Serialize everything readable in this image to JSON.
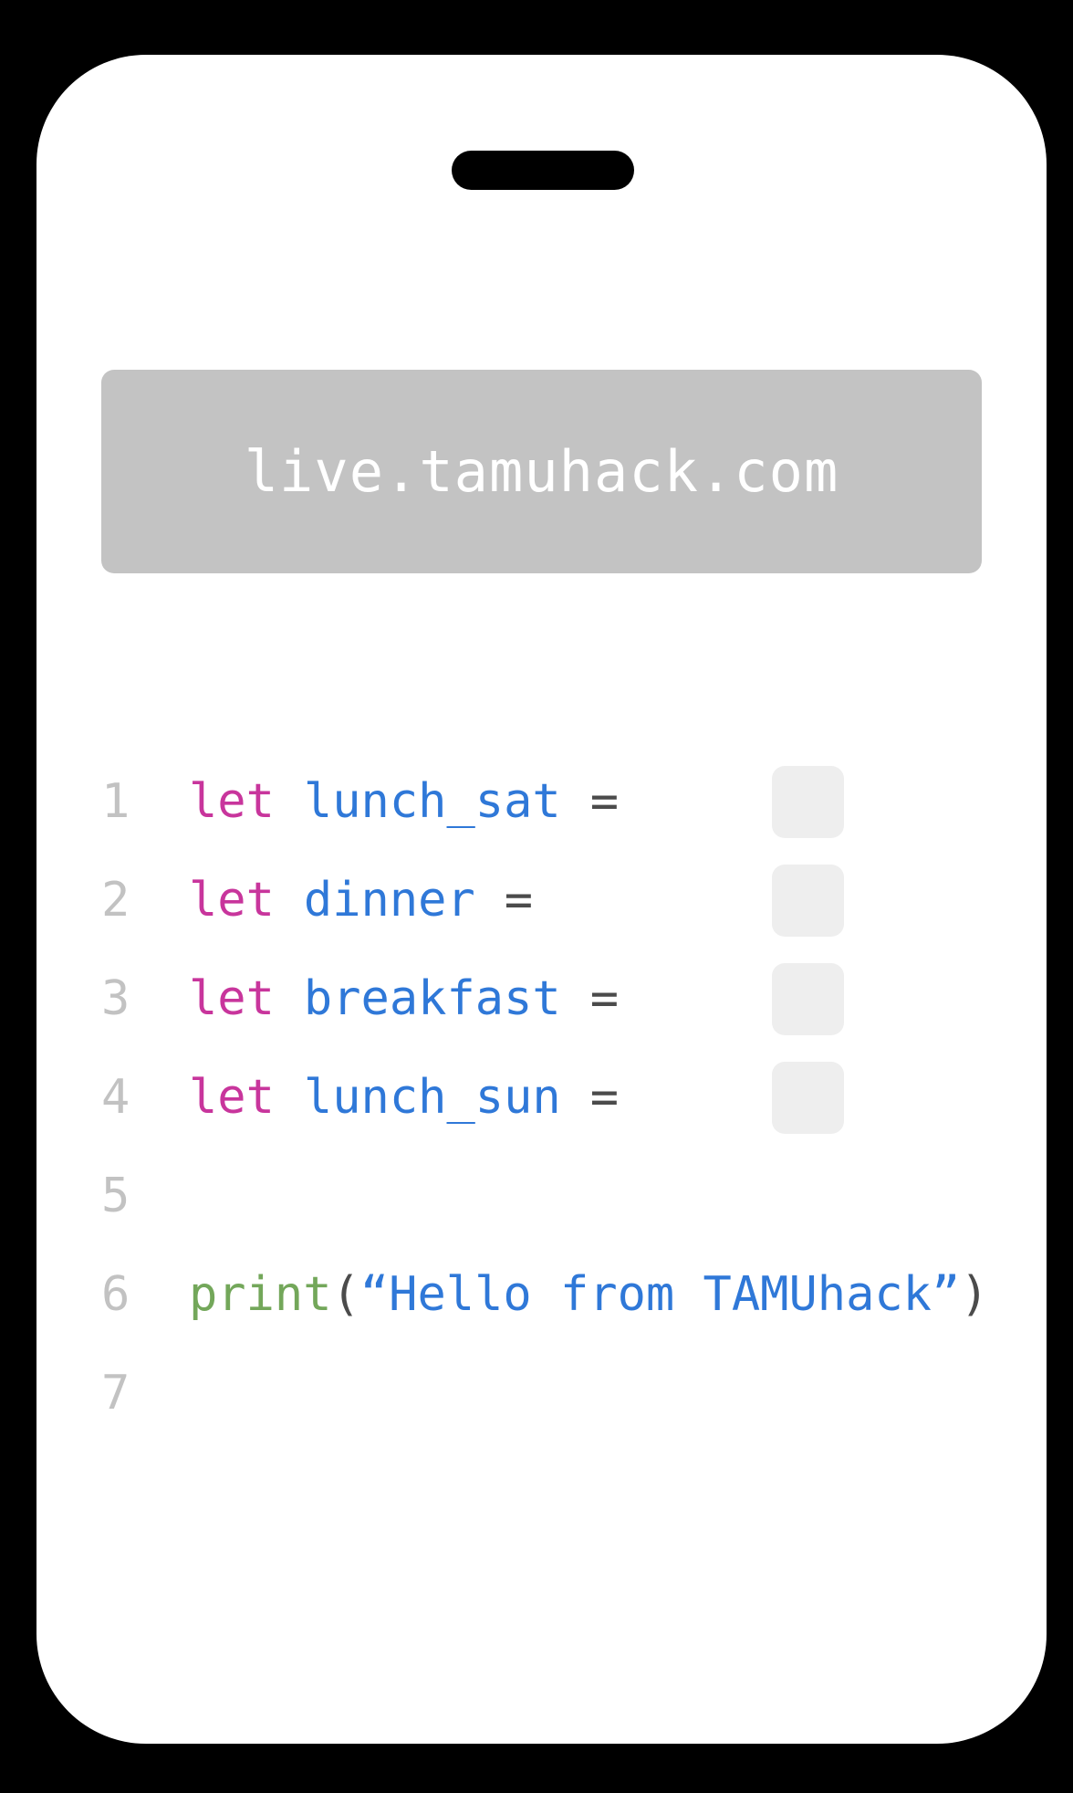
{
  "browser": {
    "url": "live.tamuhack.com"
  },
  "code_lines": [
    {
      "number": "1",
      "keyword": "let",
      "identifier": "lunch_sat",
      "operator": "="
    },
    {
      "number": "2",
      "keyword": "let",
      "identifier": "dinner",
      "operator": "="
    },
    {
      "number": "3",
      "keyword": "let",
      "identifier": "breakfast",
      "operator": "="
    },
    {
      "number": "4",
      "keyword": "let",
      "identifier": "lunch_sun",
      "operator": "="
    },
    {
      "number": "5"
    },
    {
      "number": "6",
      "function": "print",
      "open_paren": "(",
      "string": "“Hello from TAMUhack”",
      "close_paren": ")"
    },
    {
      "number": "7"
    }
  ],
  "colors": {
    "keyword": "#c8359c",
    "identifier": "#2f78d8",
    "function": "#73a75a",
    "line_number": "#c2c2c2",
    "url_bar": "#c3c3c3",
    "blank_slot": "#eeeeee"
  }
}
